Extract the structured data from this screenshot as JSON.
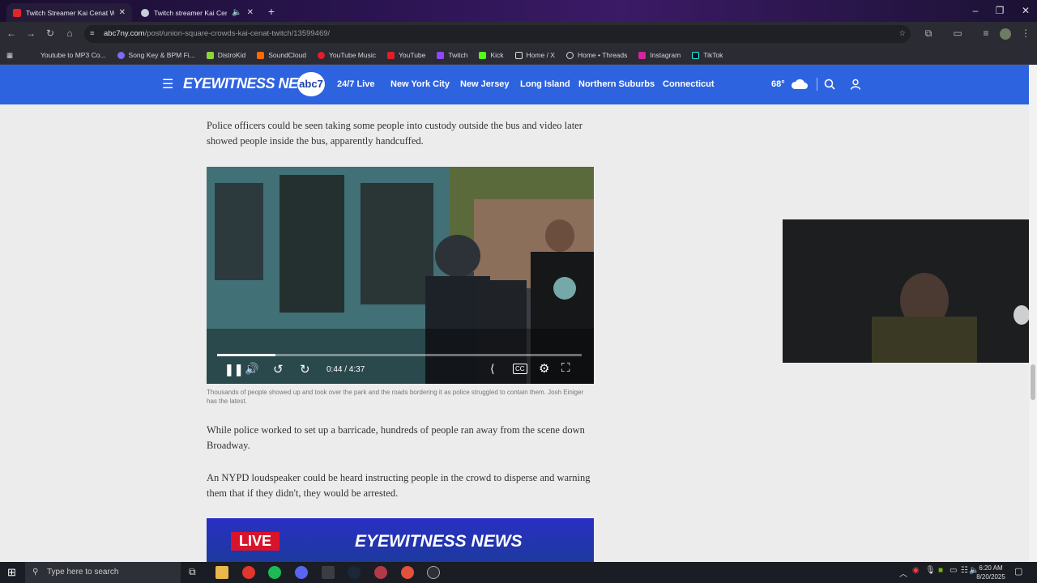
{
  "browser": {
    "tabs": [
      {
        "title": "Twitch Streamer Kai Cenat Wal...",
        "active": true
      },
      {
        "title": "Twitch streamer Kai Cenat...",
        "active": false
      }
    ],
    "url_domain": "abc7ny.com",
    "url_path": "/post/union-square-crowds-kai-cenat-twitch/13599469/",
    "bookmarks": [
      "Youtube to MP3 Co...",
      "Song Key & BPM Fi...",
      "DistroKid",
      "SoundCloud",
      "YouTube Music",
      "YouTube",
      "Twitch",
      "Kick",
      "Home / X",
      "Home • Threads",
      "Instagram",
      "TikTok"
    ]
  },
  "site": {
    "logo": "EYEWITNESS NEWS",
    "logo_badge": "abc7",
    "nav": [
      "24/7 Live",
      "New York City",
      "New Jersey",
      "Long Island",
      "Northern Suburbs",
      "Connecticut"
    ],
    "weather": "68°"
  },
  "article": {
    "p1": "Police officers could be seen taking some people into custody outside the bus and video later showed people inside the bus, apparently handcuffed.",
    "video_time": "0:44 / 4:37",
    "video_progress": 0.159,
    "caption": "Thousands of people showed up and took over the park and the roads bordering it as police struggled to contain them. Josh Einiger has the latest.",
    "p2": "While police worked to set up a barricade, hundreds of people ran away from the scene down Broadway.",
    "p3": "An NYPD loudspeaker could be heard instructing people in the crowd to disperse and warning them that if they didn't, they would be arrested.",
    "promo_live": "LIVE",
    "promo_title": "EYEWITNESS NEWS"
  },
  "taskbar": {
    "search_placeholder": "Type here to search",
    "time": "6:20 AM",
    "date": "8/20/2025"
  },
  "colors": {
    "header_blue": "#2e63e0",
    "promo_red": "#d8142c"
  }
}
